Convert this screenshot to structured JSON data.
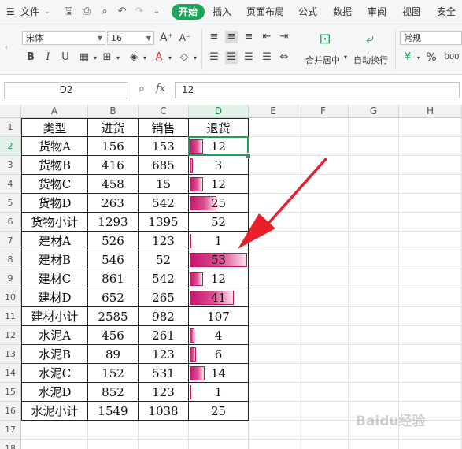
{
  "menu": {
    "file_label": "文件",
    "tabs": [
      "开始",
      "插入",
      "页面布局",
      "公式",
      "数据",
      "审阅",
      "视图",
      "安全"
    ],
    "active_tab": "开始"
  },
  "ribbon": {
    "font_name": "宋体",
    "font_size": "16",
    "merge_label": "合并居中",
    "wrap_label": "自动换行",
    "number_format": "常规",
    "percent_symbol": "%",
    "comma_symbol": "000"
  },
  "formula_bar": {
    "name_box": "D2",
    "fx_label": "fx",
    "value": "12"
  },
  "columns": [
    "A",
    "B",
    "C",
    "D",
    "E",
    "F",
    "G",
    "H"
  ],
  "rows": [
    "1",
    "2",
    "3",
    "4",
    "5",
    "6",
    "7",
    "8",
    "9",
    "10",
    "11",
    "12",
    "13",
    "14",
    "15",
    "16",
    "17",
    "18"
  ],
  "table": {
    "headers": [
      "类型",
      "进货",
      "销售",
      "退货"
    ],
    "rows": [
      {
        "type": "货物A",
        "in": "156",
        "sale": "153",
        "ret": "12",
        "bar": true
      },
      {
        "type": "货物B",
        "in": "416",
        "sale": "685",
        "ret": "3",
        "bar": true
      },
      {
        "type": "货物C",
        "in": "458",
        "sale": "15",
        "ret": "12",
        "bar": true
      },
      {
        "type": "货物D",
        "in": "263",
        "sale": "542",
        "ret": "25",
        "bar": true
      },
      {
        "type": "货物小计",
        "in": "1293",
        "sale": "1395",
        "ret": "52",
        "bar": false
      },
      {
        "type": "建材A",
        "in": "526",
        "sale": "123",
        "ret": "1",
        "bar": true
      },
      {
        "type": "建材B",
        "in": "546",
        "sale": "52",
        "ret": "53",
        "bar": true
      },
      {
        "type": "建材C",
        "in": "861",
        "sale": "542",
        "ret": "12",
        "bar": true
      },
      {
        "type": "建材D",
        "in": "652",
        "sale": "265",
        "ret": "41",
        "bar": true
      },
      {
        "type": "建材小计",
        "in": "2585",
        "sale": "982",
        "ret": "107",
        "bar": false
      },
      {
        "type": "水泥A",
        "in": "456",
        "sale": "261",
        "ret": "4",
        "bar": true
      },
      {
        "type": "水泥B",
        "in": "89",
        "sale": "123",
        "ret": "6",
        "bar": true
      },
      {
        "type": "水泥C",
        "in": "152",
        "sale": "531",
        "ret": "14",
        "bar": true
      },
      {
        "type": "水泥D",
        "in": "852",
        "sale": "123",
        "ret": "1",
        "bar": true
      },
      {
        "type": "水泥小计",
        "in": "1549",
        "sale": "1038",
        "ret": "25",
        "bar": false
      }
    ]
  },
  "databar": {
    "max_value": 53,
    "color": "#c8166e"
  },
  "selected_cell": "D2",
  "annotation": {
    "color": "#e8202a"
  },
  "watermark": "Baidu经验"
}
